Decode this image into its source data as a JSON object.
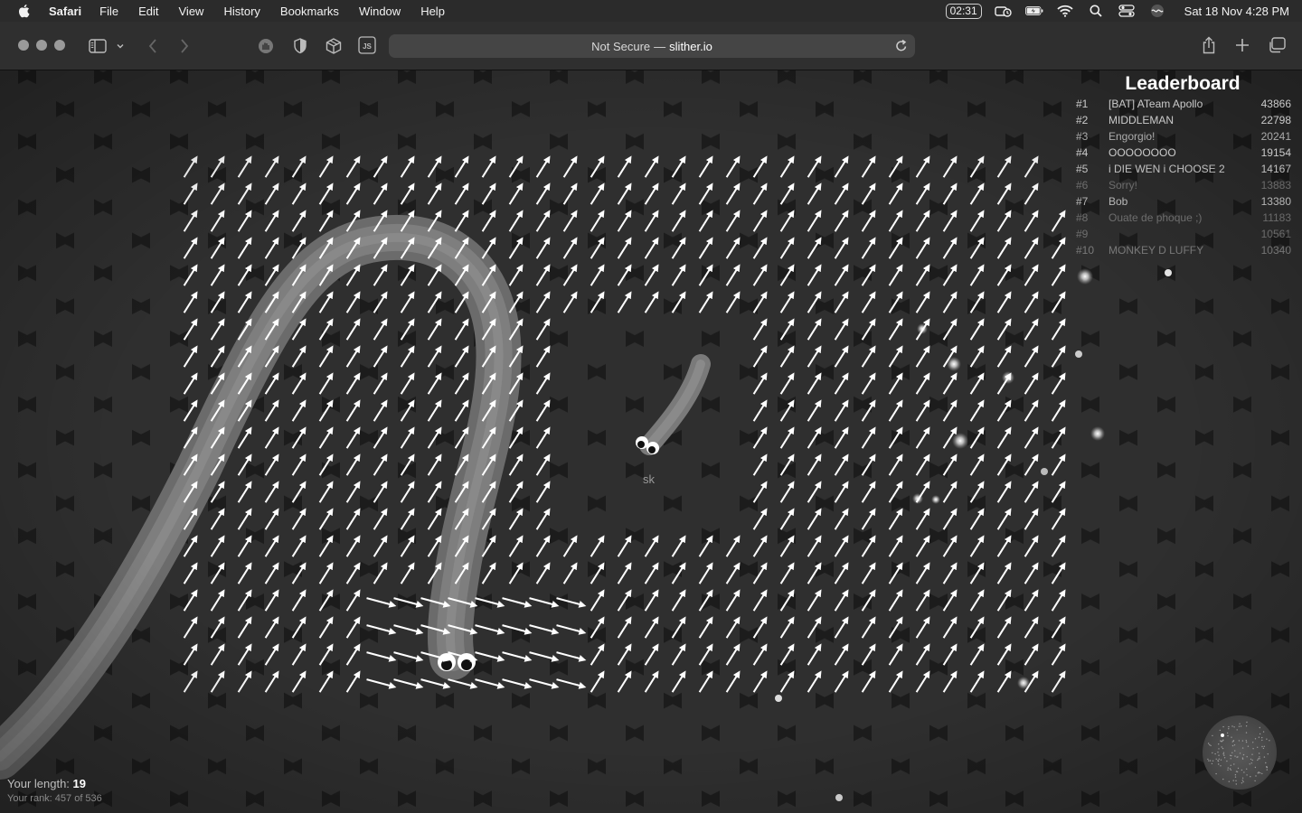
{
  "menubar": {
    "app_name": "Safari",
    "menus": [
      "File",
      "Edit",
      "View",
      "History",
      "Bookmarks",
      "Window",
      "Help"
    ],
    "timer": "02:31",
    "clock": "Sat 18 Nov  4:28 PM"
  },
  "browser": {
    "url_prefix": "Not Secure",
    "url_separator": "—",
    "url_host": "slither.io"
  },
  "game": {
    "player_name": "sk",
    "length_label": "Your length:",
    "length_value": "19",
    "rank_text": "Your rank: 457 of 536",
    "leaderboard": {
      "title": "Leaderboard",
      "entries": [
        {
          "rank": "#1",
          "name": "[BAT] ATeam Apollo",
          "score": "43866"
        },
        {
          "rank": "#2",
          "name": "MIDDLEMAN",
          "score": "22798"
        },
        {
          "rank": "#3",
          "name": "Engorgio!",
          "score": "20241"
        },
        {
          "rank": "#4",
          "name": "OOOOOOOO",
          "score": "19154"
        },
        {
          "rank": "#5",
          "name": "i DIE WEN i CHOOSE 2",
          "score": "14167"
        },
        {
          "rank": "#6",
          "name": "Sorry!",
          "score": "13883"
        },
        {
          "rank": "#7",
          "name": "Bob",
          "score": "13380"
        },
        {
          "rank": "#8",
          "name": "Ouate de phoque ;)",
          "score": "11183"
        },
        {
          "rank": "#9",
          "name": "",
          "score": "10561"
        },
        {
          "rank": "#10",
          "name": "MONKEY D LUFFY",
          "score": "10340"
        }
      ]
    }
  },
  "colors": {
    "menubar_bg": "#2b2b2b",
    "toolbar_bg": "#2f2f2f",
    "game_bg": "#1c1c1c",
    "hex_tile": "#2e2e2e",
    "arrow": "#ffffff"
  },
  "icons": [
    "apple-icon",
    "battery-icon",
    "wifi-icon",
    "spotlight-icon",
    "control-center-icon",
    "siri-icon",
    "sidebar-icon",
    "back-icon",
    "forward-icon",
    "privacy-icon",
    "shield-icon",
    "cube-icon",
    "js-icon",
    "reload-icon",
    "share-icon",
    "new-tab-icon",
    "tabs-overview-icon"
  ]
}
